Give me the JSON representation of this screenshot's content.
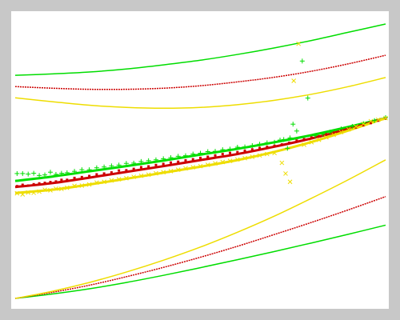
{
  "chart_data": {
    "type": "scatter",
    "title": "",
    "xlabel": "",
    "ylabel": "",
    "xlim": [
      0,
      100
    ],
    "ylim": [
      0,
      100
    ],
    "grid": false,
    "legend": "none",
    "colors": {
      "background": "#c8c8c8",
      "plot_area": "#ffffff",
      "green": "#00dd00",
      "red": "#cc0000",
      "yellow": "#eedd00"
    },
    "markers": {
      "green": "plus",
      "red": "dot",
      "yellow": "x"
    },
    "series": [
      {
        "kind": "band-upper",
        "color": "green",
        "x": [
          0,
          10,
          20,
          30,
          40,
          50,
          60,
          70,
          80,
          90,
          100
        ],
        "y": [
          81.3,
          81.8,
          82.5,
          83.6,
          85.1,
          86.8,
          88.9,
          91.3,
          94.0,
          97.0,
          100.0
        ]
      },
      {
        "kind": "band-upper",
        "color": "red",
        "x": [
          0,
          10,
          20,
          30,
          40,
          50,
          60,
          70,
          80,
          90,
          100
        ],
        "y": [
          77.2,
          76.6,
          76.2,
          76.2,
          76.6,
          77.5,
          78.9,
          80.6,
          82.8,
          85.5,
          88.6
        ]
      },
      {
        "kind": "band-upper",
        "color": "yellow",
        "x": [
          0,
          10,
          20,
          30,
          40,
          50,
          60,
          70,
          80,
          90,
          100
        ],
        "y": [
          73.1,
          71.7,
          70.4,
          69.6,
          69.3,
          69.6,
          70.6,
          72.2,
          74.4,
          77.2,
          80.5
        ]
      },
      {
        "kind": "fit",
        "color": "green",
        "x": [
          0,
          10,
          20,
          30,
          40,
          50,
          60,
          70,
          80,
          90,
          100
        ],
        "y": [
          42.8,
          44.4,
          46.3,
          48.2,
          50.2,
          52.4,
          54.5,
          56.9,
          59.5,
          62.5,
          65.7
        ]
      },
      {
        "kind": "fit",
        "color": "red",
        "x": [
          0,
          10,
          20,
          30,
          40,
          50,
          60,
          70,
          80,
          90,
          100
        ],
        "y": [
          40.6,
          42.0,
          44.0,
          46.1,
          48.2,
          50.4,
          52.6,
          55.3,
          58.3,
          61.8,
          65.7
        ]
      },
      {
        "kind": "fit",
        "color": "yellow",
        "x": [
          0,
          10,
          20,
          30,
          40,
          50,
          60,
          70,
          80,
          90,
          100
        ],
        "y": [
          38.4,
          39.6,
          41.5,
          43.6,
          45.8,
          48.0,
          50.4,
          53.4,
          57.0,
          61.2,
          65.7
        ]
      },
      {
        "kind": "band-lower",
        "color": "green",
        "x": [
          0,
          10,
          20,
          30,
          40,
          50,
          60,
          70,
          80,
          90,
          100
        ],
        "y": [
          0.0,
          1.6,
          3.5,
          5.8,
          8.4,
          11.2,
          14.1,
          17.1,
          20.2,
          23.4,
          26.7
        ]
      },
      {
        "kind": "band-lower",
        "color": "red",
        "x": [
          0,
          10,
          20,
          30,
          40,
          50,
          60,
          70,
          80,
          90,
          100
        ],
        "y": [
          0.0,
          2.2,
          4.8,
          7.9,
          11.3,
          15.0,
          19.0,
          23.3,
          27.7,
          32.3,
          37.1
        ]
      },
      {
        "kind": "band-lower",
        "color": "yellow",
        "x": [
          0,
          10,
          20,
          30,
          40,
          50,
          60,
          70,
          80,
          90,
          100
        ],
        "y": [
          0.0,
          2.6,
          5.8,
          9.6,
          13.9,
          18.7,
          24.1,
          30.0,
          36.5,
          43.3,
          50.5
        ]
      },
      {
        "kind": "scatter",
        "color": "green",
        "x": [
          0.5,
          2.0,
          3.5,
          5.0,
          6.5,
          8.0,
          9.5,
          11.0,
          12.5,
          14.0,
          16.0,
          18.0,
          20.0,
          22.0,
          24.0,
          26.0,
          28.0,
          30.0,
          32.0,
          34.0,
          36.0,
          38.0,
          40.0,
          42.0,
          44.0,
          46.0,
          48.0,
          50.0,
          52.0,
          54.0,
          56.0,
          58.0,
          60.0,
          62.0,
          64.0,
          66.0,
          68.0,
          70.0,
          71.5,
          72.5,
          73.5,
          74.2,
          75.0,
          76.0,
          77.5,
          79.0,
          81.0,
          83.0,
          85.0,
          88.0,
          91.0,
          94.0,
          97.0,
          100.0
        ],
        "y": [
          45.5,
          45.5,
          45.3,
          45.6,
          44.8,
          45.0,
          46.0,
          45.2,
          45.6,
          45.8,
          46.3,
          46.9,
          46.9,
          47.6,
          47.9,
          48.3,
          48.6,
          49.2,
          49.3,
          49.9,
          50.2,
          50.5,
          50.9,
          51.3,
          51.8,
          52.0,
          52.6,
          52.9,
          53.5,
          53.6,
          54.2,
          54.4,
          55.1,
          55.2,
          55.7,
          56.2,
          56.7,
          56.9,
          57.7,
          57.9,
          54.7,
          58.5,
          63.5,
          61.0,
          86.5,
          73.0,
          59.3,
          59.9,
          60.6,
          61.8,
          62.7,
          63.7,
          64.8,
          65.9
        ]
      },
      {
        "kind": "scatter",
        "color": "red",
        "x": [
          0.5,
          2.0,
          3.5,
          5.0,
          6.5,
          8.0,
          9.5,
          11.0,
          12.5,
          14.0,
          16.0,
          18.0,
          20.0,
          22.0,
          24.0,
          26.0,
          28.0,
          30.0,
          32.0,
          34.0,
          36.0,
          38.0,
          40.0,
          42.0,
          44.0,
          46.0,
          48.0,
          50.0,
          52.0,
          54.0,
          56.0,
          58.0,
          60.0,
          62.0,
          64.0,
          66.0,
          68.0,
          70.0,
          72.0,
          74.0,
          76.0,
          78.0,
          80.0,
          82.0,
          84.0,
          86.0,
          88.0,
          90.0,
          92.0,
          94.0,
          96.0,
          98.0,
          100.0
        ],
        "y": [
          40.9,
          41.4,
          41.1,
          41.6,
          41.9,
          42.1,
          42.4,
          42.6,
          43.2,
          43.2,
          43.9,
          44.2,
          44.6,
          45.2,
          45.5,
          45.9,
          46.6,
          46.7,
          47.2,
          47.8,
          48.1,
          48.6,
          49.0,
          49.5,
          49.8,
          50.3,
          50.7,
          51.2,
          51.6,
          52.1,
          52.6,
          53.0,
          53.3,
          53.8,
          54.3,
          54.8,
          55.2,
          55.6,
          56.1,
          56.7,
          57.5,
          58.0,
          58.6,
          59.1,
          59.8,
          60.4,
          61.0,
          61.8,
          62.3,
          63.1,
          63.9,
          64.8,
          65.6
        ]
      },
      {
        "kind": "scatter",
        "color": "yellow",
        "x": [
          0.5,
          2.0,
          3.5,
          5.0,
          6.5,
          8.0,
          9.5,
          11.0,
          12.5,
          14.0,
          16.0,
          18.0,
          20.0,
          22.0,
          24.0,
          26.0,
          28.0,
          30.0,
          32.0,
          34.0,
          36.0,
          38.0,
          40.0,
          42.0,
          44.0,
          46.0,
          48.0,
          50.0,
          52.0,
          54.0,
          56.0,
          58.0,
          60.0,
          62.0,
          64.0,
          66.0,
          68.0,
          70.0,
          72.0,
          73.0,
          74.2,
          75.2,
          76.5,
          78.0,
          80.0,
          82.0,
          84.0,
          86.0,
          88.0,
          90.0,
          92.0,
          94.0,
          96.0,
          98.0,
          100.0
        ],
        "y": [
          38.3,
          37.9,
          38.6,
          38.5,
          38.9,
          39.6,
          39.4,
          40.0,
          39.9,
          40.3,
          41.0,
          41.1,
          41.5,
          42.2,
          42.5,
          43.0,
          43.4,
          43.8,
          44.3,
          44.7,
          45.1,
          45.6,
          46.0,
          46.4,
          46.9,
          47.4,
          47.8,
          48.2,
          48.7,
          49.2,
          49.7,
          50.1,
          50.6,
          51.1,
          51.6,
          52.1,
          52.6,
          53.0,
          49.4,
          45.5,
          42.5,
          79.3,
          92.8,
          56.0,
          56.9,
          57.8,
          58.7,
          59.6,
          60.6,
          61.6,
          62.6,
          63.6,
          64.6,
          65.1,
          65.7
        ]
      }
    ]
  }
}
